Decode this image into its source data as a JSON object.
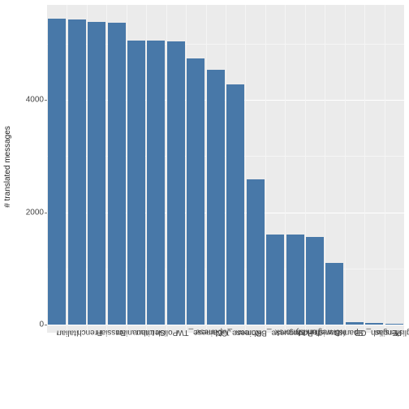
{
  "chart_data": {
    "type": "bar",
    "title": "",
    "xlabel": "",
    "ylabel": "# translated messages",
    "ylim": [
      -150,
      5700
    ],
    "yticks_major": [
      0,
      2000,
      4000
    ],
    "yticks_minor": [
      1000,
      3000,
      5000
    ],
    "categories": [
      "Italian",
      "French",
      "Russian",
      "Lithuanian",
      "German",
      "Polish",
      "Chinese_TW",
      "Japanese",
      "Chinese_CN",
      "Korean",
      "Portuguese_BR",
      "Norwegian Nynorsk",
      "Turkish",
      "Danish",
      "Spanish",
      "English_GB",
      "Persian",
      "English"
    ],
    "values": [
      5460,
      5440,
      5400,
      5380,
      5070,
      5060,
      5050,
      4740,
      4540,
      4280,
      2580,
      1600,
      1600,
      1560,
      1100,
      40,
      30,
      5
    ],
    "bar_color": "#4878a8",
    "grid_bg": "#ebebeb"
  }
}
